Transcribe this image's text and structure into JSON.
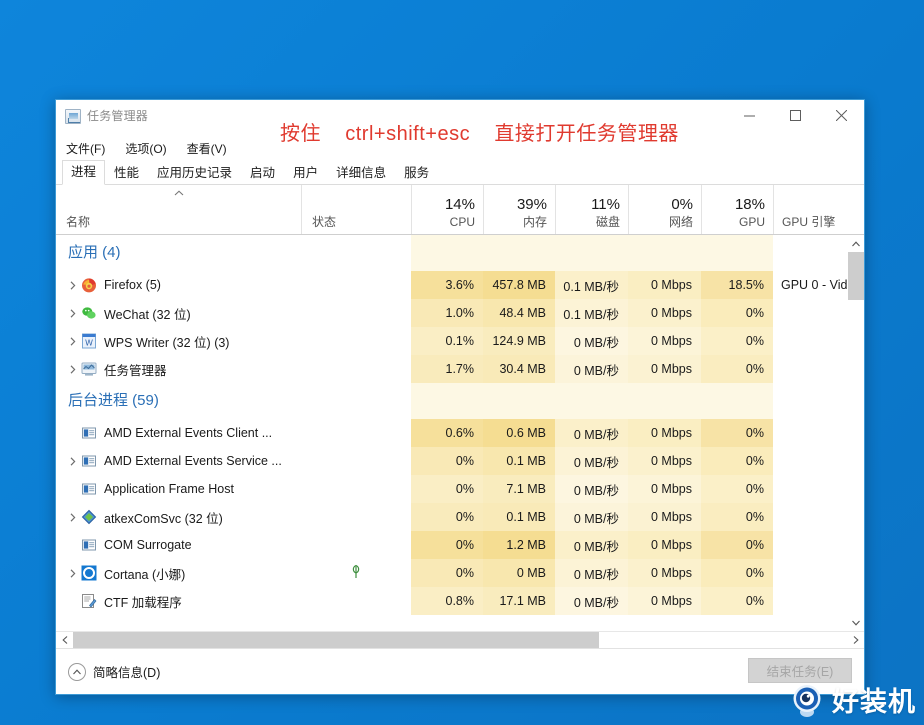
{
  "window": {
    "title": "任务管理器",
    "app_icon": "task-manager-icon",
    "controls": {
      "minimize": "minimize-icon",
      "maximize": "maximize-icon",
      "close": "close-icon"
    }
  },
  "menubar": {
    "items": [
      "文件(F)",
      "选项(O)",
      "查看(V)"
    ]
  },
  "tabs": {
    "active_index": 0,
    "items": [
      "进程",
      "性能",
      "应用历史记录",
      "启动",
      "用户",
      "详细信息",
      "服务"
    ]
  },
  "columns": [
    {
      "key": "name",
      "label": "名称",
      "pct": "",
      "sorted": true
    },
    {
      "key": "status",
      "label": "状态",
      "pct": ""
    },
    {
      "key": "cpu",
      "label": "CPU",
      "pct": "14%"
    },
    {
      "key": "memory",
      "label": "内存",
      "pct": "39%"
    },
    {
      "key": "disk",
      "label": "磁盘",
      "pct": "11%"
    },
    {
      "key": "net",
      "label": "网络",
      "pct": "0%"
    },
    {
      "key": "gpu",
      "label": "GPU",
      "pct": "18%"
    },
    {
      "key": "gpueng",
      "label": "GPU 引擎",
      "pct": ""
    }
  ],
  "groups": [
    {
      "title": "应用 (4)",
      "rows": [
        {
          "expander": "chevron-right-icon",
          "icon": "firefox-icon",
          "name": "Firefox (5)",
          "status": "",
          "cpu": "3.6%",
          "memory": "457.8 MB",
          "disk": "0.1 MB/秒",
          "net": "0 Mbps",
          "gpu": "18.5%",
          "gpueng": "GPU 0 - Vid"
        },
        {
          "expander": "chevron-right-icon",
          "icon": "wechat-icon",
          "name": "WeChat (32 位)",
          "status": "",
          "cpu": "1.0%",
          "memory": "48.4 MB",
          "disk": "0.1 MB/秒",
          "net": "0 Mbps",
          "gpu": "0%",
          "gpueng": ""
        },
        {
          "expander": "chevron-right-icon",
          "icon": "wps-writer-icon",
          "name": "WPS Writer (32 位) (3)",
          "status": "",
          "cpu": "0.1%",
          "memory": "124.9 MB",
          "disk": "0 MB/秒",
          "net": "0 Mbps",
          "gpu": "0%",
          "gpueng": ""
        },
        {
          "expander": "chevron-right-icon",
          "icon": "task-manager-icon",
          "name": "任务管理器",
          "status": "",
          "cpu": "1.7%",
          "memory": "30.4 MB",
          "disk": "0 MB/秒",
          "net": "0 Mbps",
          "gpu": "0%",
          "gpueng": ""
        }
      ]
    },
    {
      "title": "后台进程 (59)",
      "rows": [
        {
          "expander": "",
          "icon": "generic-app-icon",
          "name": "AMD External Events Client ...",
          "status": "",
          "cpu": "0.6%",
          "memory": "0.6 MB",
          "disk": "0 MB/秒",
          "net": "0 Mbps",
          "gpu": "0%",
          "gpueng": ""
        },
        {
          "expander": "chevron-right-icon",
          "icon": "generic-app-icon",
          "name": "AMD External Events Service ...",
          "status": "",
          "cpu": "0%",
          "memory": "0.1 MB",
          "disk": "0 MB/秒",
          "net": "0 Mbps",
          "gpu": "0%",
          "gpueng": ""
        },
        {
          "expander": "",
          "icon": "generic-app-icon",
          "name": "Application Frame Host",
          "status": "",
          "cpu": "0%",
          "memory": "7.1 MB",
          "disk": "0 MB/秒",
          "net": "0 Mbps",
          "gpu": "0%",
          "gpueng": ""
        },
        {
          "expander": "chevron-right-icon",
          "icon": "atkex-icon",
          "name": "atkexComSvc (32 位)",
          "status": "",
          "cpu": "0%",
          "memory": "0.1 MB",
          "disk": "0 MB/秒",
          "net": "0 Mbps",
          "gpu": "0%",
          "gpueng": ""
        },
        {
          "expander": "",
          "icon": "generic-app-icon",
          "name": "COM Surrogate",
          "status": "",
          "cpu": "0%",
          "memory": "1.2 MB",
          "disk": "0 MB/秒",
          "net": "0 Mbps",
          "gpu": "0%",
          "gpueng": ""
        },
        {
          "expander": "chevron-right-icon",
          "icon": "cortana-icon",
          "name": "Cortana (小娜)",
          "status": "green-leaf-icon",
          "cpu": "0%",
          "memory": "0 MB",
          "disk": "0 MB/秒",
          "net": "0 Mbps",
          "gpu": "0%",
          "gpueng": ""
        },
        {
          "expander": "",
          "icon": "ctf-loader-icon",
          "name": "CTF 加载程序",
          "status": "",
          "cpu": "0.8%",
          "memory": "17.1 MB",
          "disk": "0 MB/秒",
          "net": "0 Mbps",
          "gpu": "0%",
          "gpueng": ""
        }
      ]
    }
  ],
  "statusbar": {
    "fewer_details": "简略信息(D)",
    "fewer_details_accel": "D",
    "end_task": "结束任务(E)",
    "end_task_accel": "E",
    "collapse_icon": "chevron-up-circle-icon"
  },
  "annotation": {
    "prefix": "按住",
    "shortcut": "ctrl+shift+esc",
    "suffix": "直接打开任务管理器",
    "color": "#e03a2f"
  },
  "watermark": {
    "text": "好装机",
    "logo": "hao-zhuang-ji-logo"
  },
  "colors": {
    "desktop": "#0a7ed4",
    "accent": "#2a6fb6",
    "heat_low": "#fdf6dd",
    "heat_mid": "#fbefc0",
    "heat_high": "#f8e3a0",
    "annotation_red": "#e03a2f"
  }
}
